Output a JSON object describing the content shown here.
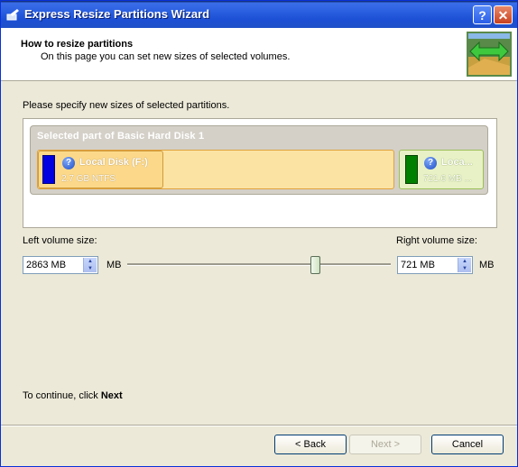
{
  "window": {
    "title": "Express Resize Partitions Wizard",
    "help_label": "?",
    "close_label": "✕"
  },
  "header": {
    "title": "How to resize partitions",
    "subtitle": "On this page you can set new sizes of selected volumes."
  },
  "instruction": "Please specify new sizes of selected partitions.",
  "disk": {
    "label": "Selected part of Basic Hard Disk 1",
    "partitions": [
      {
        "name": "Local Disk (F:)",
        "info": "2.7 GB NTFS",
        "color": "#0000e0"
      },
      {
        "name": "Loca...",
        "info": "721.6 MB ...",
        "color": "#008000"
      }
    ]
  },
  "left_volume": {
    "label": "Left volume size:",
    "value": "2863 MB",
    "unit": "MB"
  },
  "right_volume": {
    "label": "Right volume size:",
    "value": "721 MB",
    "unit": "MB"
  },
  "slider": {
    "left_fraction": 0.8
  },
  "footer": {
    "continue_prefix": "To continue, click ",
    "continue_bold": "Next"
  },
  "buttons": {
    "back": "< Back",
    "next": "Next >",
    "cancel": "Cancel"
  }
}
